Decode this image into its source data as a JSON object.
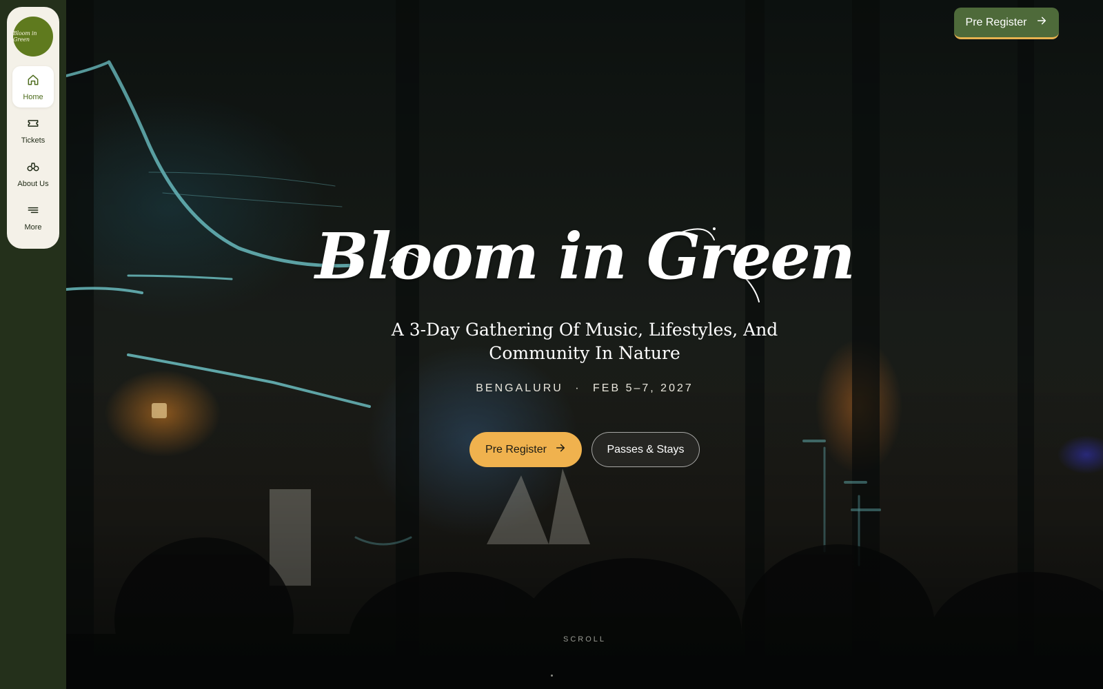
{
  "brand": {
    "logo_text": "Bloom in Green",
    "accent_green": "#5f7a1e",
    "button_green": "#4e6a3a",
    "accent_gold": "#f0b24e"
  },
  "sidebar": {
    "items": [
      {
        "label": "Home",
        "icon": "home-icon",
        "active": true
      },
      {
        "label": "Tickets",
        "icon": "ticket-icon",
        "active": false
      },
      {
        "label": "About Us",
        "icon": "binoculars-icon",
        "active": false
      },
      {
        "label": "More",
        "icon": "menu-icon",
        "active": false
      }
    ]
  },
  "header": {
    "register_label": "Pre Register"
  },
  "hero": {
    "title": "Bloom in Green",
    "tagline": "A 3-Day Gathering Of Music, Lifestyles, And Community In Nature",
    "location": "BENGALURU",
    "separator": "·",
    "dates": "FEB 5–7, 2027",
    "primary_cta": "Pre Register",
    "secondary_cta": "Passes & Stays",
    "scroll_label": "SCROLL"
  }
}
